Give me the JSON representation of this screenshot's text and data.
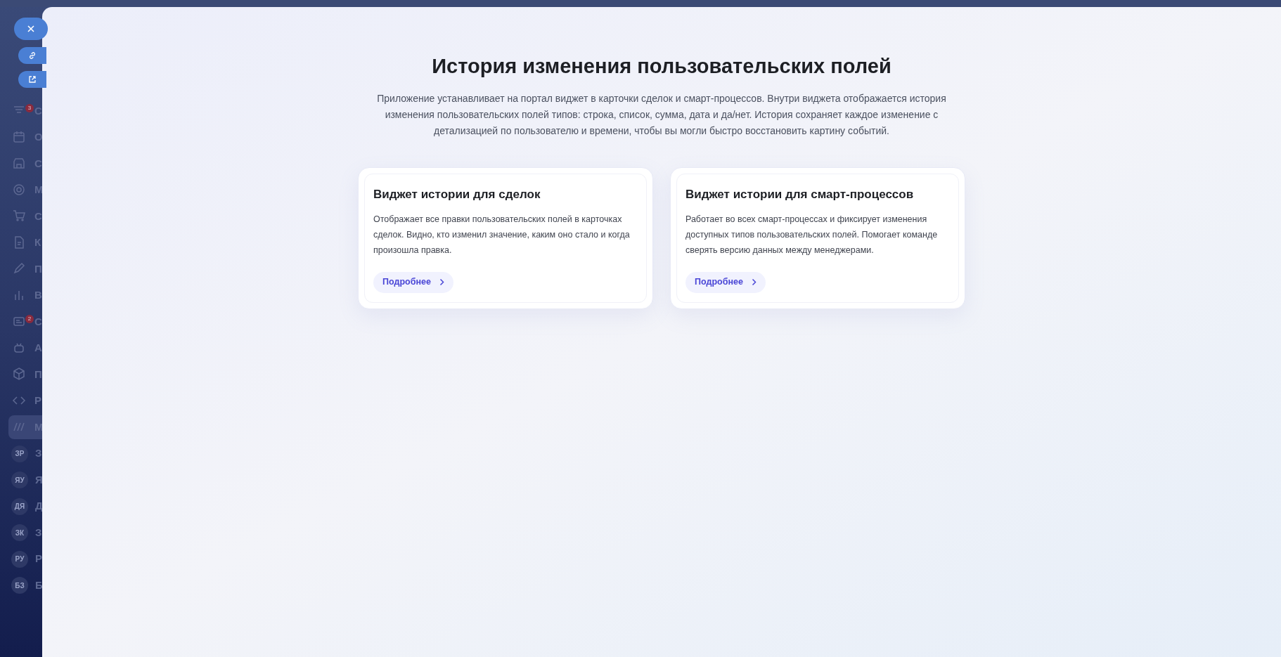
{
  "sidebar": {
    "items": [
      {
        "kind": "icon",
        "letter": "С",
        "badge": "3"
      },
      {
        "kind": "icon",
        "letter": "О"
      },
      {
        "kind": "icon",
        "letter": "С"
      },
      {
        "kind": "icon",
        "letter": "М"
      },
      {
        "kind": "icon",
        "letter": "С"
      },
      {
        "kind": "icon",
        "letter": "К"
      },
      {
        "kind": "icon",
        "letter": "П"
      },
      {
        "kind": "icon",
        "letter": "В"
      },
      {
        "kind": "icon",
        "letter": "С",
        "badge": "2"
      },
      {
        "kind": "icon",
        "letter": "А"
      },
      {
        "kind": "icon",
        "letter": "П"
      },
      {
        "kind": "icon",
        "letter": "Р"
      },
      {
        "kind": "icon",
        "letter": "М",
        "selected": true
      },
      {
        "kind": "avatar",
        "avatar": "ЗР",
        "letter": "З"
      },
      {
        "kind": "avatar",
        "avatar": "ЯУ",
        "letter": "Я"
      },
      {
        "kind": "avatar",
        "avatar": "ДЯ",
        "letter": "Д"
      },
      {
        "kind": "avatar",
        "avatar": "ЗК",
        "letter": "З"
      },
      {
        "kind": "avatar",
        "avatar": "РУ",
        "letter": "Р"
      },
      {
        "kind": "avatar",
        "avatar": "БЗ",
        "letter": "Б"
      }
    ]
  },
  "slider": {
    "title": "История изменения пользовательских полей",
    "description": "Приложение устанавливает на портал виджет в карточки сделок и смарт-процессов. Внутри виджета отображается история изменения пользовательских полей типов: строка, список, сумма, дата и да/нет. История сохраняет каждое изменение с детализацией по пользователю и времени, чтобы вы могли быстро восстановить картину событий.",
    "cards": [
      {
        "title": "Виджет истории для сделок",
        "text": "Отображает все правки пользовательских полей в карточках сделок. Видно, кто изменил значение, каким оно стало и когда произошла правка.",
        "button": "Подробнее"
      },
      {
        "title": "Виджет истории для смарт-процессов",
        "text": "Работает во всех смарт-процессах и фиксирует изменения доступных типов пользовательских полей. Помогает команде сверять версию данных между менеджерами.",
        "button": "Подробнее"
      }
    ]
  }
}
